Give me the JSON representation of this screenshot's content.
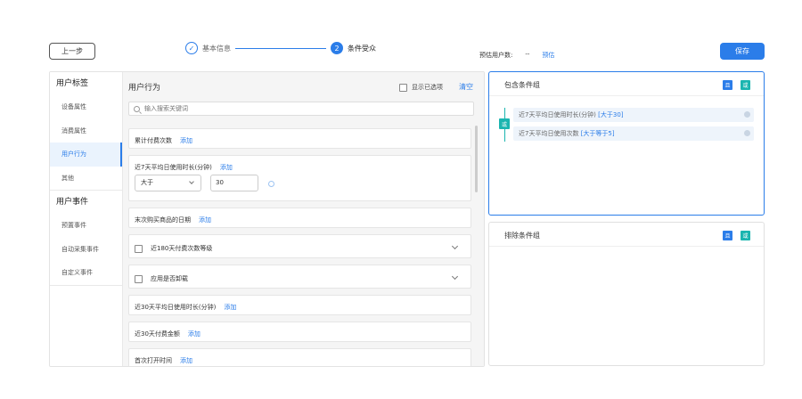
{
  "toolbar": {
    "prev_label": "上一步",
    "save_label": "保存"
  },
  "steps": [
    {
      "label": "基本信息",
      "marker": "✓",
      "state": "done"
    },
    {
      "label": "条件受众",
      "marker": "2",
      "state": "active"
    }
  ],
  "estimate": {
    "label": "预估用户数:",
    "value": "--",
    "action": "预估"
  },
  "sidebar": {
    "group1": "用户标签",
    "items1": [
      "设备属性",
      "消费属性",
      "用户行为",
      "其他"
    ],
    "group2": "用户事件",
    "items2": [
      "预置事件",
      "自动采集事件",
      "自定义事件"
    ]
  },
  "content": {
    "header": "用户行为",
    "show_selected": "显示已选项",
    "clear": "清空",
    "search_placeholder": "输入搜索关键词",
    "add_label": "添加",
    "cards": [
      {
        "title": "累计付费次数"
      },
      {
        "title": "近7天平均日使用时长(分钟)",
        "operator": "大于",
        "value": "30"
      },
      {
        "title": "末次购买商品的日期"
      },
      {
        "title": "近180天付费次数等级"
      },
      {
        "title": "应用是否卸载"
      },
      {
        "title": "近30天平均日使用时长(分钟)"
      },
      {
        "title": "近30天付费金额"
      },
      {
        "title": "首次打开时间"
      }
    ]
  },
  "include": {
    "title": "包含条件组",
    "and": "且",
    "or": "或",
    "or_badge": "或",
    "conditions": [
      {
        "text": "近7天平均日使用时长(分钟)",
        "value": "[大于30]"
      },
      {
        "text": "近7天平均日使用次数",
        "value": "[大于等于5]"
      }
    ]
  },
  "exclude": {
    "title": "排除条件组",
    "and": "且",
    "or": "或"
  },
  "colors": {
    "accent": "#2b7de9",
    "teal": "#1bb5b0"
  }
}
